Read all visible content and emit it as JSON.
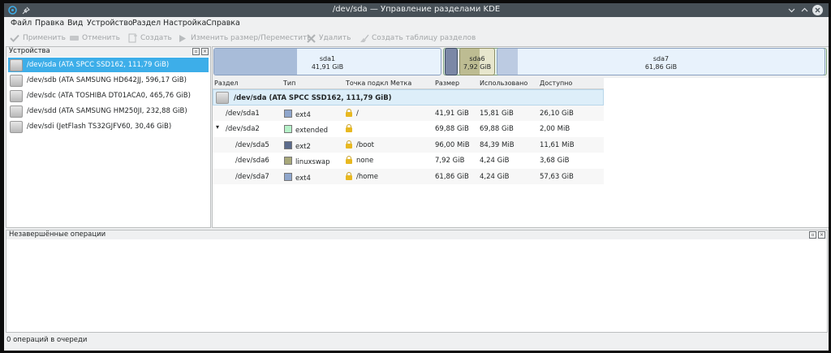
{
  "window": {
    "title": "/dev/sda — Управление разделами KDE"
  },
  "menu": [
    "Файл",
    "Правка",
    "Вид",
    "Устройство",
    "Раздел",
    "Настройка",
    "Справка"
  ],
  "toolbar": {
    "apply": "Применить",
    "undo": "Отменить",
    "create": "Создать",
    "resize": "Изменить размер/Переместить",
    "delete": "Удалить",
    "new_table": "Создать таблицу разделов"
  },
  "devices": {
    "title": "Устройства",
    "items": [
      "/dev/sda (ATA SPCC SSD162, 111,79 GiB)",
      "/dev/sdb (ATA SAMSUNG HD642JJ, 596,17 GiB)",
      "/dev/sdc (ATA TOSHIBA DT01ACA0, 465,76 GiB)",
      "/dev/sdd (ATA SAMSUNG HM250JI, 232,88 GiB)",
      "/dev/sdi (JetFlash TS32GJFV60, 30,46 GiB)"
    ]
  },
  "graph": {
    "sda1": {
      "name": "sda1",
      "size": "41,91 GiB"
    },
    "sda6": {
      "name": "sda6",
      "size": "7,92 GiB"
    },
    "sda7": {
      "name": "sda7",
      "size": "61,86 GiB"
    }
  },
  "table": {
    "headers": [
      "Раздел",
      "Тип",
      "Точка подкл",
      "Метка",
      "Размер",
      "Использовано",
      "Доступно"
    ],
    "disk_row": "/dev/sda (ATA SPCC SSD162, 111,79 GiB)",
    "rows": [
      {
        "name": "/dev/sda1",
        "type": "ext4",
        "mount": "/",
        "size": "41,91 GiB",
        "used": "15,81 GiB",
        "avail": "26,10 GiB"
      },
      {
        "name": "/dev/sda2",
        "type": "extended",
        "mount": "",
        "size": "69,88 GiB",
        "used": "69,88 GiB",
        "avail": "2,00 MiB"
      },
      {
        "name": "/dev/sda5",
        "type": "ext2",
        "mount": "/boot",
        "size": "96,00 MiB",
        "used": "84,39 MiB",
        "avail": "11,61 MiB"
      },
      {
        "name": "/dev/sda6",
        "type": "linuxswap",
        "mount": "none",
        "size": "7,92 GiB",
        "used": "4,24 GiB",
        "avail": "3,68 GiB"
      },
      {
        "name": "/dev/sda7",
        "type": "ext4",
        "mount": "/home",
        "size": "61,86 GiB",
        "used": "4,24 GiB",
        "avail": "57,63 GiB"
      }
    ],
    "colors": {
      "ext4": "#8fa6cc",
      "extended": "#b6f2c9",
      "ext2": "#5b6b8c",
      "linuxswap": "#a8a87a"
    }
  },
  "pending": {
    "title": "Незавершённые операции"
  },
  "status": {
    "text": "0 операций в очереди"
  }
}
